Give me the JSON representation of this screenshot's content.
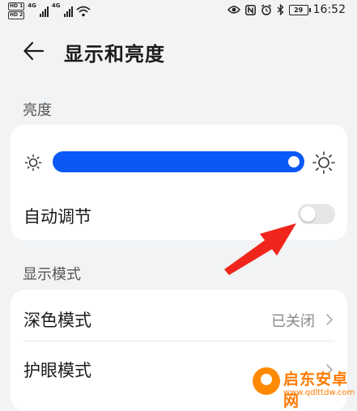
{
  "status_bar": {
    "hd_1": "HD 1",
    "hd_2": "HD 2",
    "net_1": "4G",
    "net_2": "4G",
    "battery": "29",
    "time": "16:52"
  },
  "header": {
    "title": "显示和亮度"
  },
  "brightness": {
    "section_title": "亮度",
    "level": 1.0,
    "auto_adjust_label": "自动调节",
    "auto_adjust_on": false
  },
  "display_mode": {
    "section_title": "显示模式",
    "dark_mode_label": "深色模式",
    "dark_mode_value": "已关闭",
    "eye_comfort_label": "护眼模式"
  },
  "watermark": {
    "name": "启东安卓网",
    "url": "www.qdlttdw.com"
  },
  "colors": {
    "accent": "#0a59f7",
    "annotation": "#f0261c",
    "background": "#f1f3f5"
  }
}
